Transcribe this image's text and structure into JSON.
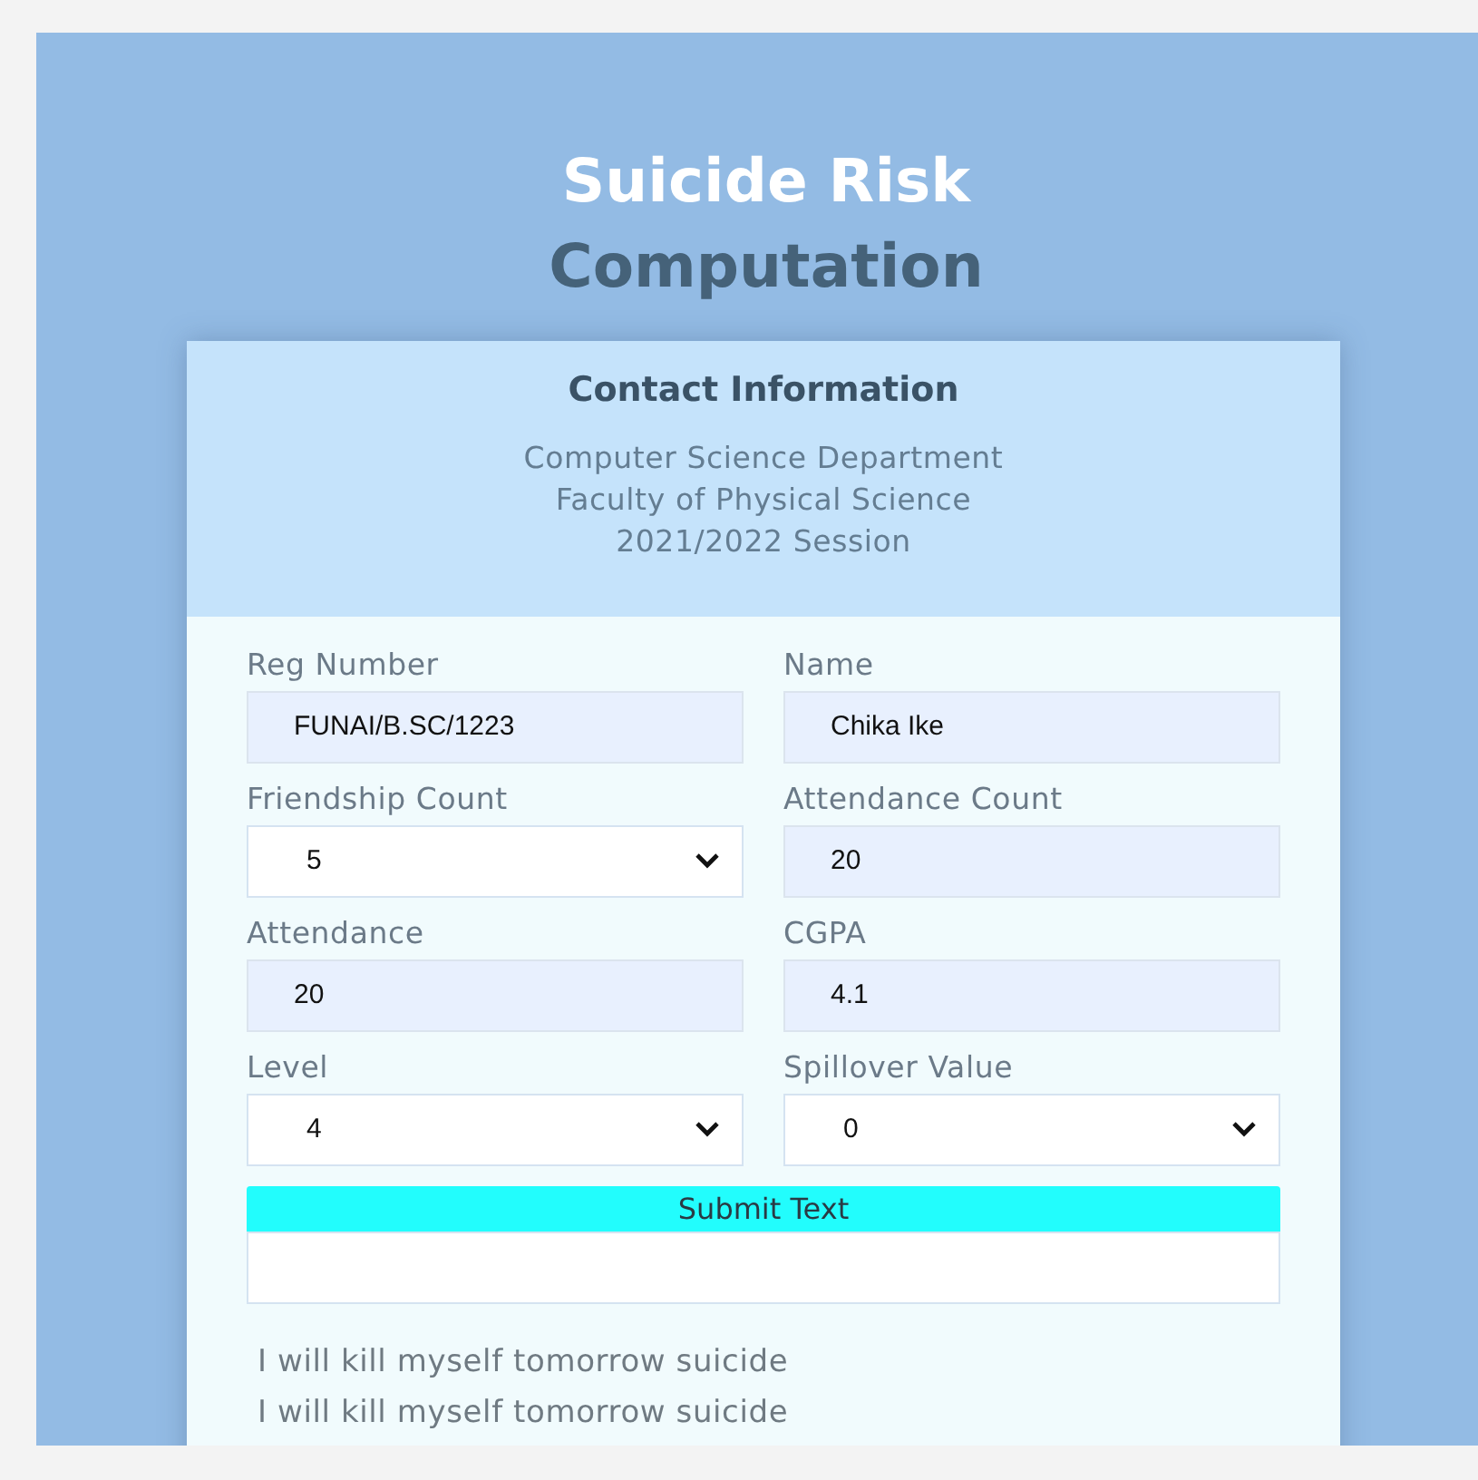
{
  "title": {
    "line_1": "Suicide Risk",
    "line_2": "Computation"
  },
  "contact": {
    "heading": "Contact Information",
    "lines": [
      "Computer Science Department",
      "Faculty of Physical Science",
      "2021/2022 Session"
    ]
  },
  "fields": [
    {
      "label": "Reg Number",
      "kind": "input",
      "value": "FUNAI/B.SC/1223"
    },
    {
      "label": "Name",
      "kind": "input",
      "value": "Chika Ike"
    },
    {
      "label": "Friendship Count",
      "kind": "select",
      "value": "5"
    },
    {
      "label": "Attendance Count",
      "kind": "input",
      "value": "20"
    },
    {
      "label": "Attendance",
      "kind": "input",
      "value": "20"
    },
    {
      "label": "CGPA",
      "kind": "input",
      "value": "4.1"
    },
    {
      "label": "Level",
      "kind": "select",
      "value": "4"
    },
    {
      "label": "Spillover Value",
      "kind": "select",
      "value": "0"
    }
  ],
  "submit_button": "Submit Text",
  "results": [
    "I will kill myself tomorrow suicide",
    "I will kill myself tomorrow suicide"
  ]
}
